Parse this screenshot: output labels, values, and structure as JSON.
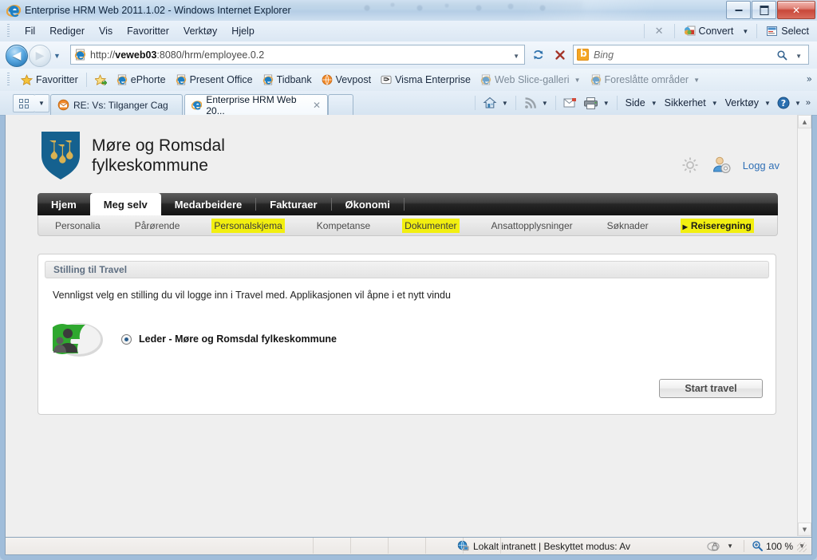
{
  "window": {
    "title": "Enterprise HRM Web 2011.1.02 - Windows Internet Explorer",
    "minimize_label": "Minimer",
    "maximize_label": "Maksimer",
    "close_label": "Lukk"
  },
  "menubar": {
    "items": [
      "Fil",
      "Rediger",
      "Vis",
      "Favoritter",
      "Verktøy",
      "Hjelp"
    ],
    "close_x": "✕",
    "convert_label": "Convert",
    "convert_caret": "▼",
    "select_label": "Select"
  },
  "address": {
    "back_arrow": "◀",
    "forward_arrow": "▶",
    "history_caret": "▼",
    "url_prefix": "http://",
    "url_host": "veweb03",
    "url_rest": ":8080/hrm/employee.0.2",
    "url_full": "http://veweb03:8080/hrm/employee.0.2",
    "url_caret": "▼",
    "refresh_icon": "refresh-icon",
    "stop_icon": "stop-icon",
    "search_placeholder": "Bing",
    "search_value": "",
    "search_caret": "▼"
  },
  "favorites": {
    "label": "Favoritter",
    "add_label": "Legg til i Favoritter-feltet",
    "items": [
      {
        "label": "ePhorte",
        "icon": "ie-page-icon",
        "dim": false
      },
      {
        "label": "Present Office",
        "icon": "ie-page-icon",
        "dim": false
      },
      {
        "label": "Tidbank",
        "icon": "ie-page-icon",
        "dim": false
      },
      {
        "label": "Vevpost",
        "icon": "vevpost-icon",
        "dim": false
      },
      {
        "label": "Visma Enterprise",
        "icon": "visma-icon",
        "dim": false
      },
      {
        "label": "Web Slice-galleri",
        "icon": "ie-page-icon",
        "dim": true,
        "caret": "▼"
      },
      {
        "label": "Foreslåtte områder",
        "icon": "ie-page-icon",
        "dim": true,
        "caret": "▼"
      }
    ],
    "overflow": "»"
  },
  "tabs": {
    "quick_tabs_label": "Hurtigfaner",
    "tab_list_caret": "▼",
    "items": [
      {
        "label": "RE: Vs: Tilganger Cag",
        "icon": "mail-icon",
        "active": false
      },
      {
        "label": "Enterprise HRM Web 20...",
        "icon": "ie-icon",
        "active": true,
        "close": "✕"
      }
    ],
    "new_tab_label": "Ny fane"
  },
  "commandbar": {
    "home_caret": "▼",
    "feeds_caret": "▼",
    "print_caret": "▼",
    "items": [
      {
        "label": "Side",
        "caret": "▼"
      },
      {
        "label": "Sikkerhet",
        "caret": "▼"
      },
      {
        "label": "Verktøy",
        "caret": "▼"
      }
    ],
    "help_caret": "▼",
    "overflow": "»"
  },
  "page": {
    "brand": {
      "line1": "Møre og Romsdal",
      "line2": "fylkeskommune",
      "logo_icon": "more-og-romsdal-shield-logo"
    },
    "header_actions": {
      "settings_icon": "gear-icon",
      "user_settings_icon": "user-gear-icon",
      "logout_label": "Logg av"
    },
    "main_tabs": [
      {
        "label": "Hjem",
        "active": false
      },
      {
        "label": "Meg selv",
        "active": true
      },
      {
        "label": "Medarbeidere",
        "active": false
      },
      {
        "label": "Fakturaer",
        "active": false
      },
      {
        "label": "Økonomi",
        "active": false
      }
    ],
    "sub_nav": [
      {
        "label": "Personalia",
        "highlight": false,
        "current": false
      },
      {
        "label": "Pårørende",
        "highlight": false,
        "current": false
      },
      {
        "label": "Personalskjema",
        "highlight": true,
        "current": false
      },
      {
        "label": "Kompetanse",
        "highlight": false,
        "current": false
      },
      {
        "label": "Dokumenter",
        "highlight": true,
        "current": false
      },
      {
        "label": "Ansattopplysninger",
        "highlight": false,
        "current": false
      },
      {
        "label": "Søknader",
        "highlight": false,
        "current": false
      },
      {
        "label": "Reiseregning",
        "highlight": true,
        "current": true,
        "marker": "▶"
      }
    ],
    "panel": {
      "title": "Stilling til Travel",
      "description": "Vennligst velg en stilling du vil logge inn i Travel med. Applikasjonen vil åpne i et nytt vindu",
      "app_icon": "etravel-logo",
      "options": [
        {
          "label": "Leder - Møre og Romsdal fylkeskommune",
          "selected": true
        }
      ],
      "submit_label": "Start travel"
    },
    "colors": {
      "shield_blue": "#15618f",
      "shield_gold": "#d9b252",
      "highlight_yellow": "#f2ef10",
      "link_blue": "#2f6fb5",
      "panel_title": "#5f6f82"
    }
  },
  "statusbar": {
    "zone_icon": "local-intranet-icon",
    "zone_text": "Lokalt intranett | Beskyttet modus: Av",
    "privacy_icon": "privacy-lock-icon",
    "privacy_caret": "▼",
    "zoom_icon": "zoom-icon",
    "zoom_level": "100 %",
    "zoom_caret": "▼"
  },
  "scrollbar": {
    "up_arrow": "▲",
    "down_arrow": "▼"
  }
}
